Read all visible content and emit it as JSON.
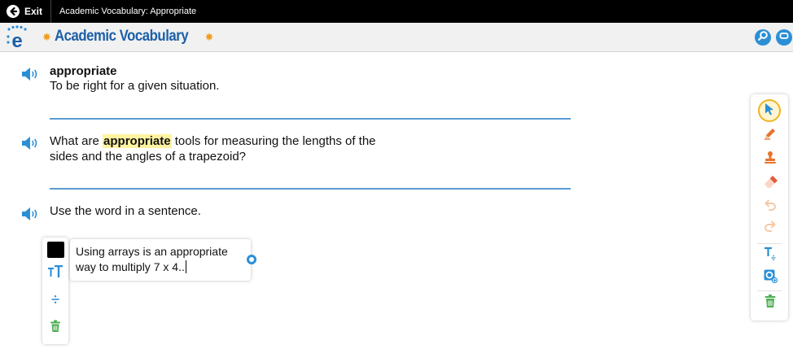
{
  "topbar": {
    "exit_label": "Exit",
    "window_title": "Academic Vocabulary: Appropriate"
  },
  "app": {
    "title": "Academic Vocabulary",
    "logo_letter": "e"
  },
  "content": {
    "word": "appropriate",
    "definition": "To be right for a given situation.",
    "question_before": "What are ",
    "question_highlight": "appropriate",
    "question_after": " tools for measuring the lengths of the sides and the angles of a trapezoid?",
    "prompt": "Use the word in a sentence.",
    "sentence_value": "Using arrays is an appropriate way to multiply 7 x 4.."
  },
  "colors": {
    "accent_blue": "#2b8fd6",
    "title_blue": "#1c5fa8",
    "star_orange": "#f0a01e",
    "highlight_yellow": "#fff3a0",
    "selected_ring": "#f0b323",
    "pencil_orange": "#e8732c",
    "eraser_red": "#e05a3c",
    "trash_green": "#4caf50"
  },
  "icons": {
    "speaker": "speaker-icon",
    "select": "pointer-icon",
    "pencil": "pencil-icon",
    "stamp": "stamp-icon",
    "eraser": "eraser-icon",
    "undo": "undo-icon",
    "redo": "redo-icon",
    "text": "text-tool-icon",
    "zoom": "zoom-icon",
    "trash": "trash-icon"
  }
}
